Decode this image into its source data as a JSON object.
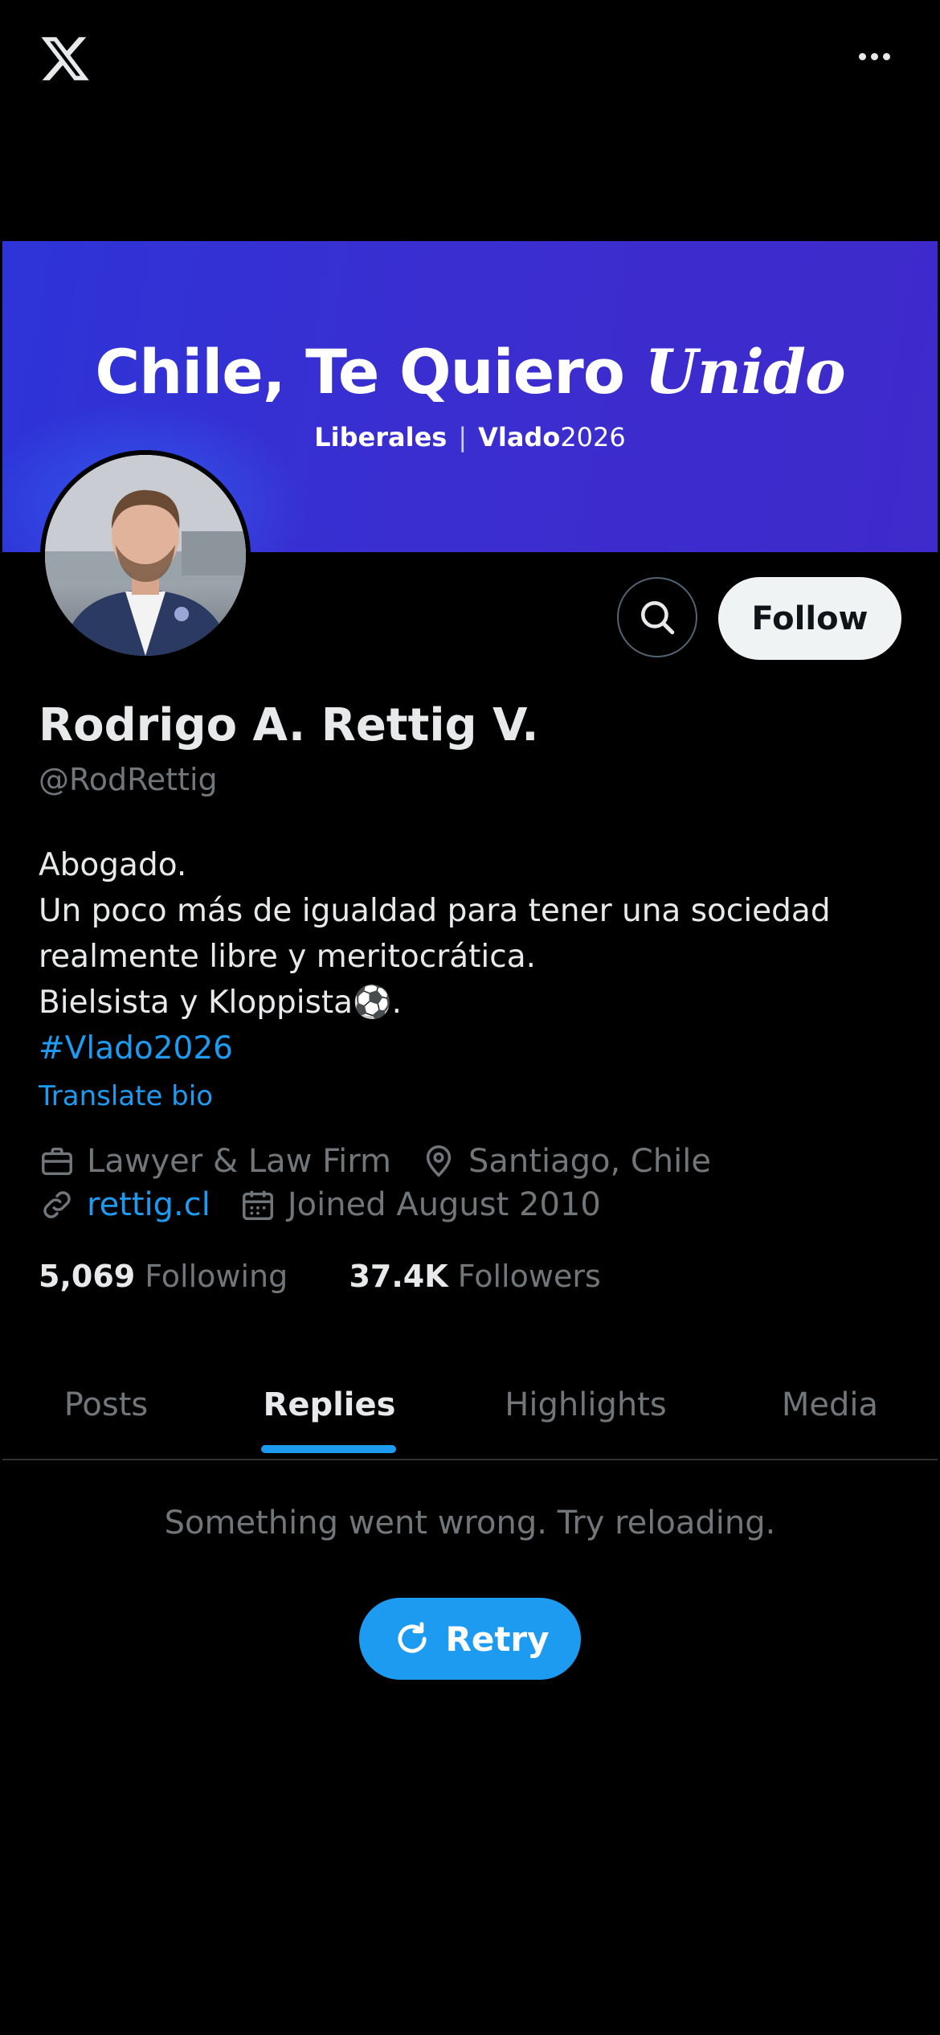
{
  "topbar": {
    "logo_icon": "x-logo-icon",
    "more_icon": "more-icon"
  },
  "banner": {
    "title_main": "Chile, Te Quiero",
    "title_italic": "Unido",
    "sub_left": "Liberales",
    "sub_sep": "|",
    "sub_right_bold": "Vlado",
    "sub_right_light": "2026",
    "bg_color": "#3a2ed0"
  },
  "profile": {
    "name": "Rodrigo A. Rettig V.",
    "handle": "@RodRettig",
    "bio_lines": [
      "Abogado.",
      "Un poco más de igualdad para tener una sociedad",
      "realmente libre y meritocrática.",
      "Bielsista y Kloppista⚽."
    ],
    "hashtag": "#Vlado2026",
    "translate_label": "Translate bio",
    "category": "Lawyer & Law Firm",
    "location": "Santiago, Chile",
    "website": "rettig.cl",
    "joined": "Joined August 2010",
    "following_count": "5,069",
    "following_label": "Following",
    "followers_count": "37.4K",
    "followers_label": "Followers"
  },
  "actions": {
    "follow_label": "Follow",
    "search_icon": "search-icon"
  },
  "tabs": [
    {
      "label": "Posts",
      "active": false
    },
    {
      "label": "Replies",
      "active": true
    },
    {
      "label": "Highlights",
      "active": false
    },
    {
      "label": "Media",
      "active": false
    }
  ],
  "error": {
    "message": "Something went wrong. Try reloading.",
    "retry_label": "Retry"
  },
  "colors": {
    "accent": "#1d9bf0",
    "background": "#000000",
    "muted_text": "#71767b"
  }
}
